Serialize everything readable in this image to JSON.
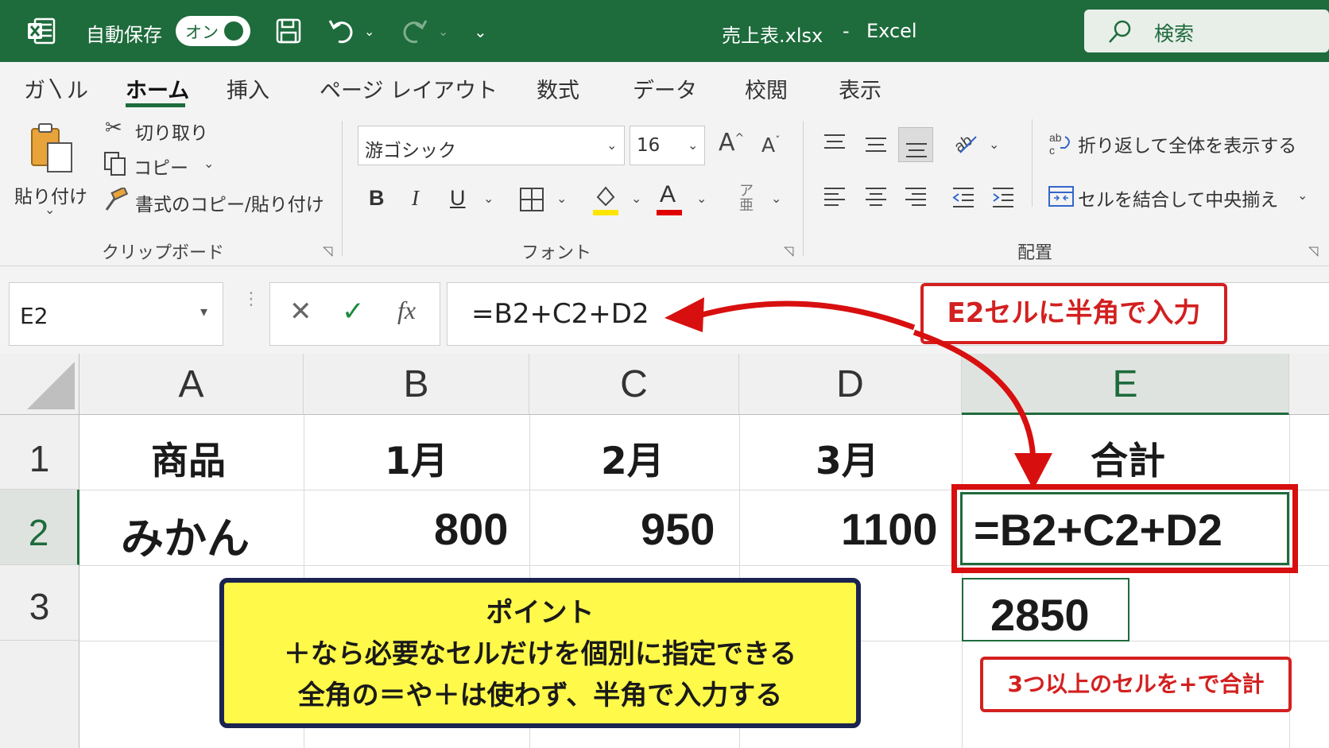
{
  "titlebar": {
    "autosave_label": "自動保存",
    "autosave_toggle": "オン",
    "document_title": "売上表.xlsx",
    "title_separator": "-",
    "app_name": "Excel",
    "search_label": "検索"
  },
  "ribbon": {
    "tabs": [
      "ガ〵ル",
      "ホーム",
      "挿入",
      "ページ レイアウト",
      "数式",
      "データ",
      "校閲",
      "表示"
    ],
    "active_tab": "ホーム",
    "clipboard": {
      "paste_label": "貼り付け",
      "cut_label": "切り取り",
      "copy_label": "コピー",
      "format_painter_label": "書式のコピー/貼り付け",
      "group_label": "クリップボード"
    },
    "font": {
      "font_name": "游ゴシック",
      "font_size": "16",
      "bold": "B",
      "italic": "I",
      "underline": "U",
      "font_color_letter": "A",
      "group_label": "フォント",
      "fill_color": "#ffe600",
      "font_color": "#e00000"
    },
    "alignment": {
      "wrap_text_label": "折り返して全体を表示する",
      "merge_center_label": "セルを結合して中央揃え",
      "group_label": "配置"
    }
  },
  "formula_bar": {
    "name_box": "E2",
    "formula": "=B2+C2+D2"
  },
  "sheet": {
    "columns": [
      "A",
      "B",
      "C",
      "D",
      "E"
    ],
    "selected_column": "E",
    "rows": [
      "1",
      "2",
      "3"
    ],
    "selected_row": "2",
    "cells": {
      "A1": "商品",
      "B1": "1月",
      "C1": "2月",
      "D1": "3月",
      "E1": "合計",
      "A2": "みかん",
      "B2": "800",
      "C2": "950",
      "D2": "1100",
      "E2": "=B2+C2+D2",
      "E3": "2850"
    }
  },
  "annotations": {
    "callout_top": "E2セルに半角で入力",
    "callout_bottom": "3つ以上のセルを+で合計",
    "point_title": "ポイント",
    "point_line1": "＋なら必要なセルだけを個別に指定できる",
    "point_line2": "全角の＝や＋は使わず、半角で入力する",
    "accent_red": "#d32020",
    "point_bg": "#fff94a",
    "point_border": "#1b2450"
  },
  "colors": {
    "excel_green": "#1e6b3c"
  }
}
